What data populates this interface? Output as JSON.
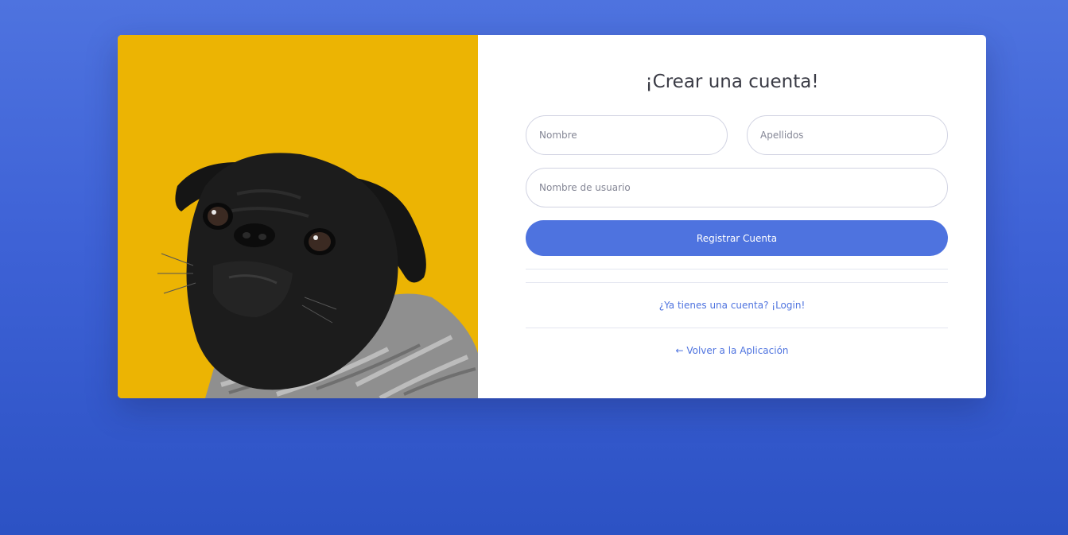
{
  "page": {
    "background_color": "#4e73df"
  },
  "image_panel": {
    "description_icon": "pug-photo",
    "background_color": "#ecb403"
  },
  "form": {
    "title": "¡Crear una cuenta!",
    "first_name": {
      "placeholder": "Nombre",
      "value": ""
    },
    "last_name": {
      "placeholder": "Apellidos",
      "value": ""
    },
    "username": {
      "placeholder": "Nombre de usuario",
      "value": ""
    },
    "register_button": "Registrar Cuenta",
    "accent_color": "#4e73df"
  },
  "links": {
    "login": "¿Ya tienes una cuenta? ¡Login!",
    "back": "← Volver a la Aplicación"
  }
}
